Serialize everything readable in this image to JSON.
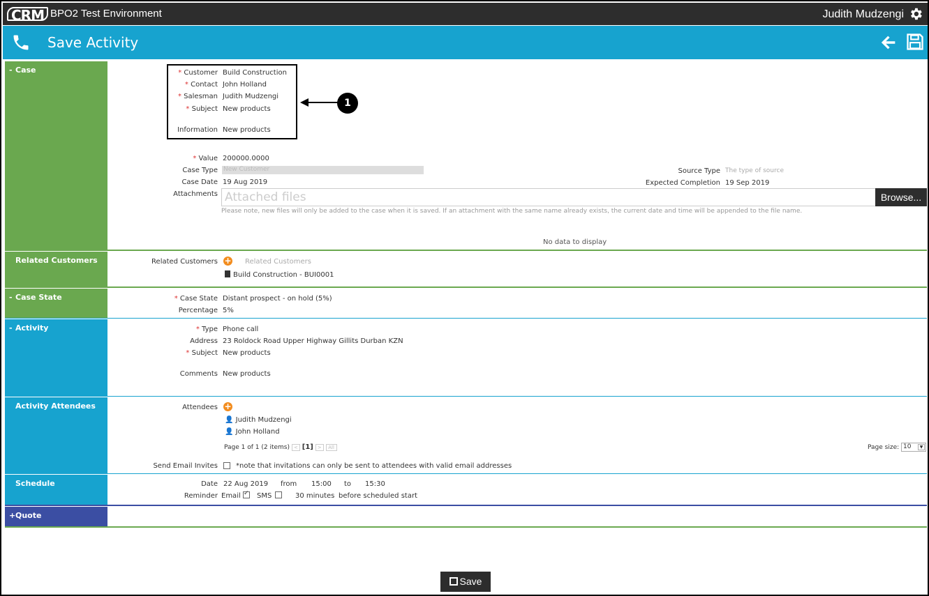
{
  "header": {
    "logo_text": "CRM",
    "env_title": "BPO2 Test Environment",
    "user_name": "Judith Mudzengi"
  },
  "titlebar": {
    "title": "Save Activity"
  },
  "sections": {
    "case": "Case",
    "related_customers": "Related Customers",
    "case_state": "Case State",
    "activity": "Activity",
    "activity_attendees": "Activity Attendees",
    "schedule": "Schedule",
    "quote": "Quote"
  },
  "case": {
    "customer_label": "Customer",
    "customer_value": "Build Construction",
    "contact_label": "Contact",
    "contact_value": "John Holland",
    "salesman_label": "Salesman",
    "salesman_value": "Judith Mudzengi",
    "subject_label": "Subject",
    "subject_value": "New products",
    "information_label": "Information",
    "information_value": "New products",
    "value_label": "Value",
    "value_value": "200000.0000",
    "case_type_label": "Case Type",
    "case_type_value": "New Customer",
    "source_type_label": "Source Type",
    "source_type_placeholder": "The type of source",
    "case_date_label": "Case Date",
    "case_date_value": "19 Aug 2019",
    "expected_completion_label": "Expected Completion",
    "expected_completion_value": "19 Sep 2019",
    "attachments_label": "Attachments",
    "attachments_placeholder": "Attached files",
    "browse_label": "Browse...",
    "attach_note": "Please note, new files will only be added to the case when it is saved. If an attachment with the same name already exists, the current date and time will be appended to the file name.",
    "no_data": "No data to display",
    "callout_number": "1"
  },
  "related_customers": {
    "label": "Related Customers",
    "placeholder": "Related Customers",
    "item": "Build Construction - BUI0001"
  },
  "case_state": {
    "state_label": "Case State",
    "state_value": "Distant prospect - on hold (5%)",
    "percentage_label": "Percentage",
    "percentage_value": "5%"
  },
  "activity": {
    "type_label": "Type",
    "type_value": "Phone call",
    "address_label": "Address",
    "address_value": "23 Roldock Road Upper Highway Gillits Durban KZN",
    "subject_label": "Subject",
    "subject_value": "New products",
    "comments_label": "Comments",
    "comments_value": "New products"
  },
  "attendees": {
    "label": "Attendees",
    "items": [
      "Judith Mudzengi",
      "John Holland"
    ],
    "pager_text": "Page 1 of 1 (2 items)",
    "current_page": "[1]",
    "all_label": "All",
    "page_size_label": "Page size:",
    "page_size_value": "10",
    "send_email_label": "Send Email Invites",
    "send_email_note": "*note that invitations can only be sent to attendees with valid email addresses"
  },
  "schedule": {
    "date_label": "Date",
    "date_value": "22 Aug 2019",
    "from_label": "from",
    "from_value": "15:00",
    "to_label": "to",
    "to_value": "15:30",
    "reminder_label": "Reminder",
    "email_label": "Email",
    "email_checked": true,
    "sms_label": "SMS",
    "sms_checked": false,
    "minutes_value": "30 minutes",
    "before_label": "before scheduled start"
  },
  "footer": {
    "save_label": "Save"
  },
  "colors": {
    "green": "#6aa84f",
    "blue": "#17a3cf",
    "purple": "#3b4ea3",
    "dark": "#2d2d2d",
    "orange": "#f28c1e"
  }
}
